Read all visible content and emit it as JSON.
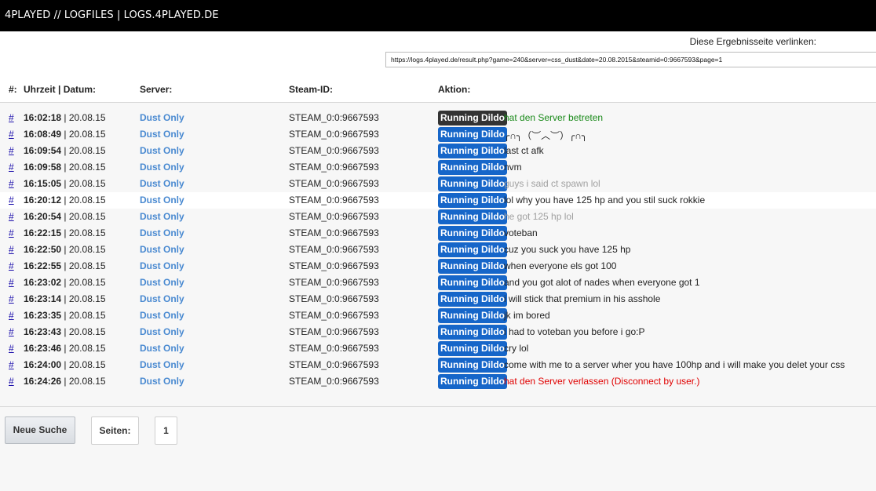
{
  "topbar": {
    "title": "4PLAYED // LOGFILES | LOGS.4PLAYED.DE"
  },
  "permalink": {
    "label": "Diese Ergebnisseite verlinken:",
    "value": "https://logs.4played.de/result.php?game=240&server=css_dust&date=20.08.2015&steamid=0:9667593&page=1"
  },
  "table": {
    "headers": {
      "hash": "#:",
      "time": "Uhrzeit | Datum:",
      "server": "Server:",
      "steam": "Steam-ID:",
      "action": "Aktion:"
    },
    "rows": [
      {
        "hash": "#",
        "time": "16:02:18",
        "date": " | 20.08.15",
        "server": "Dust Only",
        "steam": "STEAM_0:0:9667593",
        "name": "Running Dildo",
        "message": "hat den Server betreten",
        "type": "join"
      },
      {
        "hash": "#",
        "time": "16:08:49",
        "date": " | 20.08.15",
        "server": "Dust Only",
        "steam": "STEAM_0:0:9667593",
        "name": "Running Dildo",
        "message": "╭∩╮（︶︿︶）╭∩╮",
        "type": "say"
      },
      {
        "hash": "#",
        "time": "16:09:54",
        "date": " | 20.08.15",
        "server": "Dust Only",
        "steam": "STEAM_0:0:9667593",
        "name": "Running Dildo",
        "message": "last ct afk",
        "type": "say"
      },
      {
        "hash": "#",
        "time": "16:09:58",
        "date": " | 20.08.15",
        "server": "Dust Only",
        "steam": "STEAM_0:0:9667593",
        "name": "Running Dildo",
        "message": "nvm",
        "type": "say"
      },
      {
        "hash": "#",
        "time": "16:15:05",
        "date": " | 20.08.15",
        "server": "Dust Only",
        "steam": "STEAM_0:0:9667593",
        "name": "Running Dildo",
        "message": "guys i said ct spawn lol",
        "type": "dead"
      },
      {
        "hash": "#",
        "time": "16:20:12",
        "date": " | 20.08.15",
        "server": "Dust Only",
        "steam": "STEAM_0:0:9667593",
        "name": "Running Dildo",
        "message": "lol why you have 125 hp and you stil suck rokkie",
        "type": "say"
      },
      {
        "hash": "#",
        "time": "16:20:54",
        "date": " | 20.08.15",
        "server": "Dust Only",
        "steam": "STEAM_0:0:9667593",
        "name": "Running Dildo",
        "message": "he got 125 hp lol",
        "type": "dead"
      },
      {
        "hash": "#",
        "time": "16:22:15",
        "date": " | 20.08.15",
        "server": "Dust Only",
        "steam": "STEAM_0:0:9667593",
        "name": "Running Dildo",
        "message": "voteban",
        "type": "say"
      },
      {
        "hash": "#",
        "time": "16:22:50",
        "date": " | 20.08.15",
        "server": "Dust Only",
        "steam": "STEAM_0:0:9667593",
        "name": "Running Dildo",
        "message": "cuz you suck you have 125 hp",
        "type": "say"
      },
      {
        "hash": "#",
        "time": "16:22:55",
        "date": " | 20.08.15",
        "server": "Dust Only",
        "steam": "STEAM_0:0:9667593",
        "name": "Running Dildo",
        "message": "when everyone els got 100",
        "type": "say"
      },
      {
        "hash": "#",
        "time": "16:23:02",
        "date": " | 20.08.15",
        "server": "Dust Only",
        "steam": "STEAM_0:0:9667593",
        "name": "Running Dildo",
        "message": "and you got alot of nades when everyone got 1",
        "type": "say"
      },
      {
        "hash": "#",
        "time": "16:23:14",
        "date": " | 20.08.15",
        "server": "Dust Only",
        "steam": "STEAM_0:0:9667593",
        "name": "Running Dildo",
        "message": "i will stick that premium in his asshole",
        "type": "say"
      },
      {
        "hash": "#",
        "time": "16:23:35",
        "date": " | 20.08.15",
        "server": "Dust Only",
        "steam": "STEAM_0:0:9667593",
        "name": "Running Dildo",
        "message": "jk im bored",
        "type": "say"
      },
      {
        "hash": "#",
        "time": "16:23:43",
        "date": " | 20.08.15",
        "server": "Dust Only",
        "steam": "STEAM_0:0:9667593",
        "name": "Running Dildo",
        "message": "i had to voteban you before i go:P",
        "type": "say"
      },
      {
        "hash": "#",
        "time": "16:23:46",
        "date": " | 20.08.15",
        "server": "Dust Only",
        "steam": "STEAM_0:0:9667593",
        "name": "Running Dildo",
        "message": "cry lol",
        "type": "say"
      },
      {
        "hash": "#",
        "time": "16:24:00",
        "date": " | 20.08.15",
        "server": "Dust Only",
        "steam": "STEAM_0:0:9667593",
        "name": "Running Dildo",
        "message": "come with me to a server wher you have 100hp and i will make you delet your css",
        "type": "say"
      },
      {
        "hash": "#",
        "time": "16:24:26",
        "date": " | 20.08.15",
        "server": "Dust Only",
        "steam": "STEAM_0:0:9667593",
        "name": "Running Dildo",
        "message": "hat den Server verlassen (Disconnect by user.)",
        "type": "leave"
      }
    ],
    "highlighted_row": 5
  },
  "pagination": {
    "new_search": "Neue Suche",
    "pages_label": "Seiten:",
    "pages": [
      "1"
    ]
  },
  "colors": {
    "topbar": "#000000",
    "name_badge": "#1666c9",
    "name_badge_join": "#333333",
    "server_link": "#4a8ad1",
    "join_text": "#1a8a1a",
    "leave_text": "#e00000",
    "dead_text": "#a0a0a0"
  }
}
